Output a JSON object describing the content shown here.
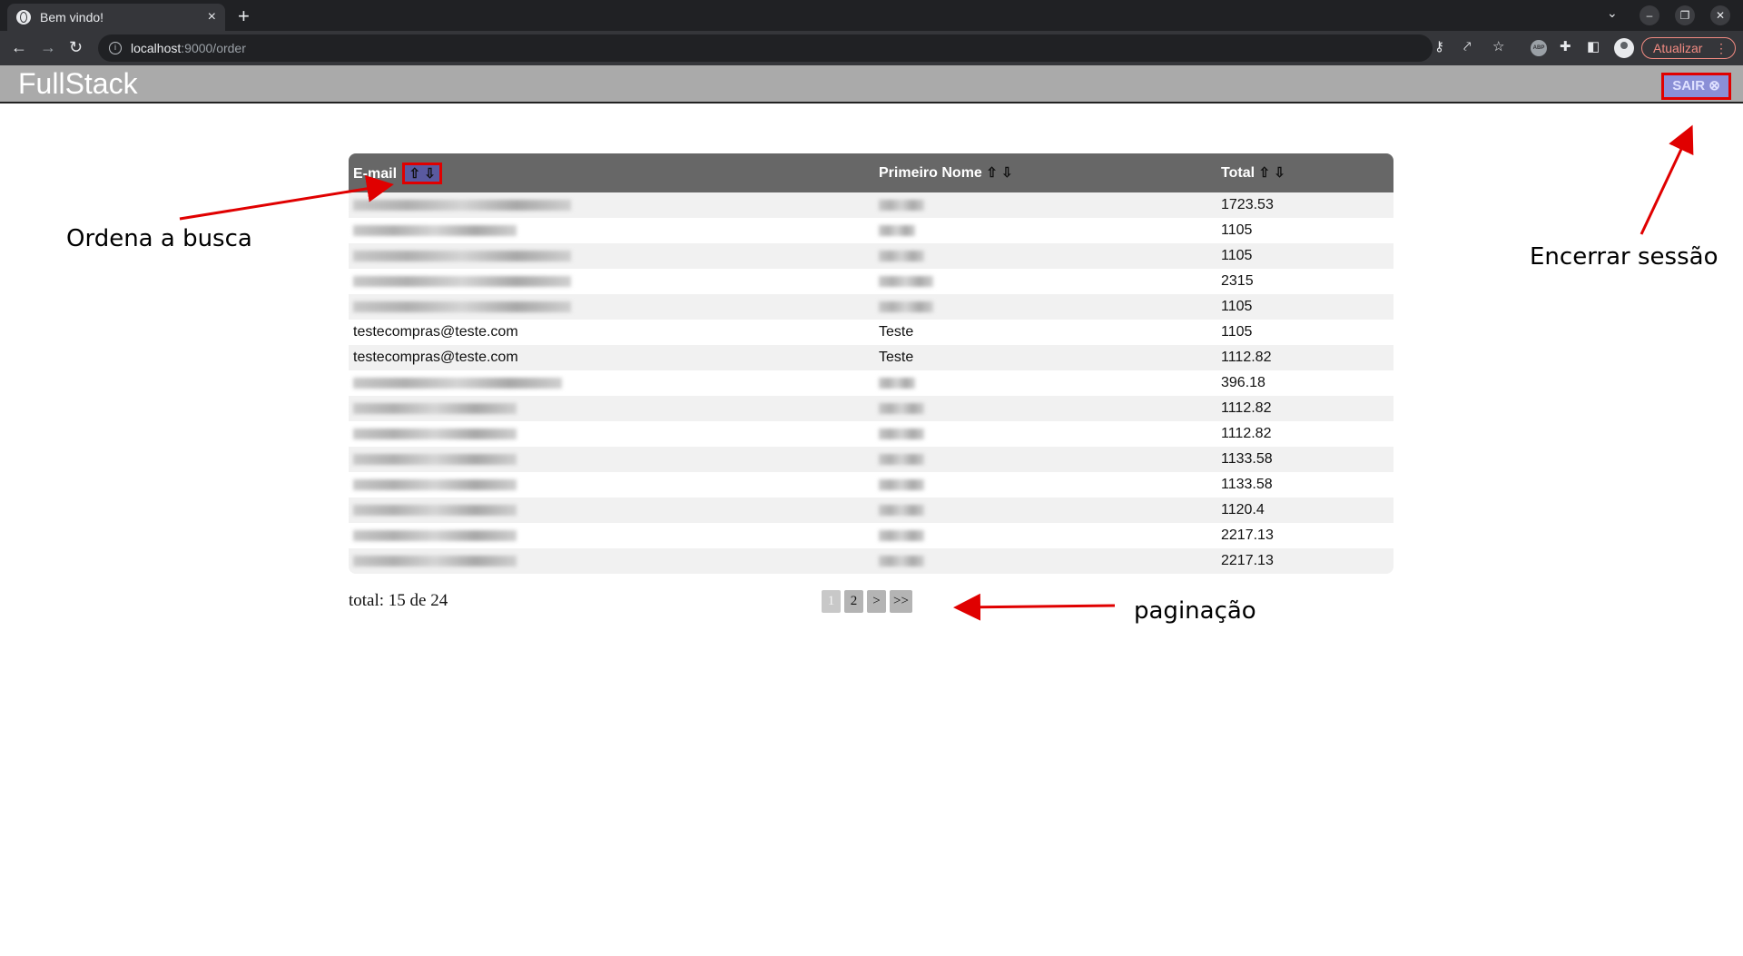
{
  "browser": {
    "tab_title": "Bem vindo!",
    "tab_close": "×",
    "new_tab": "+",
    "url_host": "localhost",
    "url_path": ":9000/order",
    "update_label": "Atualizar",
    "update_menu": "⋮"
  },
  "app": {
    "brand": "FullStack",
    "logout_label": "SAIR ⊗"
  },
  "table": {
    "headers": {
      "email": "E-mail",
      "first_name": "Primeiro Nome",
      "total": "Total",
      "sort_icons": "⇧ ⇩"
    },
    "rows": [
      {
        "email": "",
        "first_name": "",
        "total": "1723.53",
        "blur_email": 240,
        "blur_name": 50
      },
      {
        "email": "",
        "first_name": "",
        "total": "1105",
        "blur_email": 180,
        "blur_name": 40
      },
      {
        "email": "",
        "first_name": "",
        "total": "1105",
        "blur_email": 240,
        "blur_name": 50
      },
      {
        "email": "",
        "first_name": "",
        "total": "2315",
        "blur_email": 240,
        "blur_name": 60
      },
      {
        "email": "",
        "first_name": "",
        "total": "1105",
        "blur_email": 240,
        "blur_name": 60
      },
      {
        "email": "testecompras@teste.com",
        "first_name": "Teste",
        "total": "1105"
      },
      {
        "email": "testecompras@teste.com",
        "first_name": "Teste",
        "total": "1112.82"
      },
      {
        "email": "",
        "first_name": "",
        "total": "396.18",
        "blur_email": 230,
        "blur_name": 40
      },
      {
        "email": "",
        "first_name": "",
        "total": "1112.82",
        "blur_email": 180,
        "blur_name": 50
      },
      {
        "email": "",
        "first_name": "",
        "total": "1112.82",
        "blur_email": 180,
        "blur_name": 50
      },
      {
        "email": "",
        "first_name": "",
        "total": "1133.58",
        "blur_email": 180,
        "blur_name": 50
      },
      {
        "email": "",
        "first_name": "",
        "total": "1133.58",
        "blur_email": 180,
        "blur_name": 50
      },
      {
        "email": "",
        "first_name": "",
        "total": "1120.4",
        "blur_email": 180,
        "blur_name": 50
      },
      {
        "email": "",
        "first_name": "",
        "total": "2217.13",
        "blur_email": 180,
        "blur_name": 50
      },
      {
        "email": "",
        "first_name": "",
        "total": "2217.13",
        "blur_email": 180,
        "blur_name": 50
      }
    ]
  },
  "footer": {
    "total_text": "total: 15 de 24",
    "pages": [
      "1",
      "2",
      ">",
      ">>"
    ],
    "current_page": "1"
  },
  "annotations": {
    "sort": "Ordena a busca",
    "logout": "Encerrar sessão",
    "pagination": "paginação",
    "color": "#e00000"
  }
}
